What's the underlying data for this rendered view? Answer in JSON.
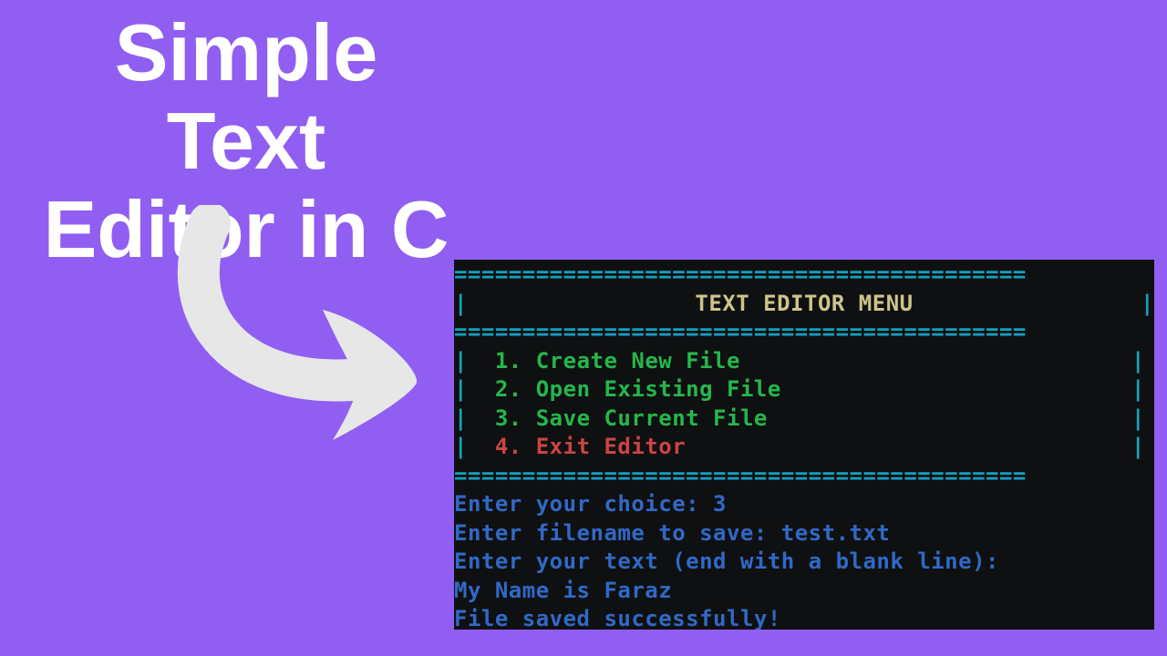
{
  "headline": {
    "line1": "Simple Text",
    "line2": "Editor in C"
  },
  "terminal": {
    "sep": "==========================================",
    "title_bar": {
      "left": "|",
      "title": "TEXT EDITOR MENU",
      "right": "|"
    },
    "menu": [
      {
        "num": "1.",
        "label": "Create New File",
        "color": "green"
      },
      {
        "num": "2.",
        "label": "Open Existing File",
        "color": "green"
      },
      {
        "num": "3.",
        "label": "Save Current File",
        "color": "green"
      },
      {
        "num": "4.",
        "label": "Exit Editor",
        "color": "red"
      }
    ],
    "menu_border_left": "|",
    "menu_border_right": "|",
    "prompts": {
      "choice_label": "Enter your choice: ",
      "choice_value": "3",
      "filename_label": "Enter filename to save: ",
      "filename_value": "test.txt",
      "enter_text": "Enter your text (end with a blank line):",
      "user_input": "My Name is Faraz",
      "saved_msg": "File saved successfully!"
    }
  }
}
